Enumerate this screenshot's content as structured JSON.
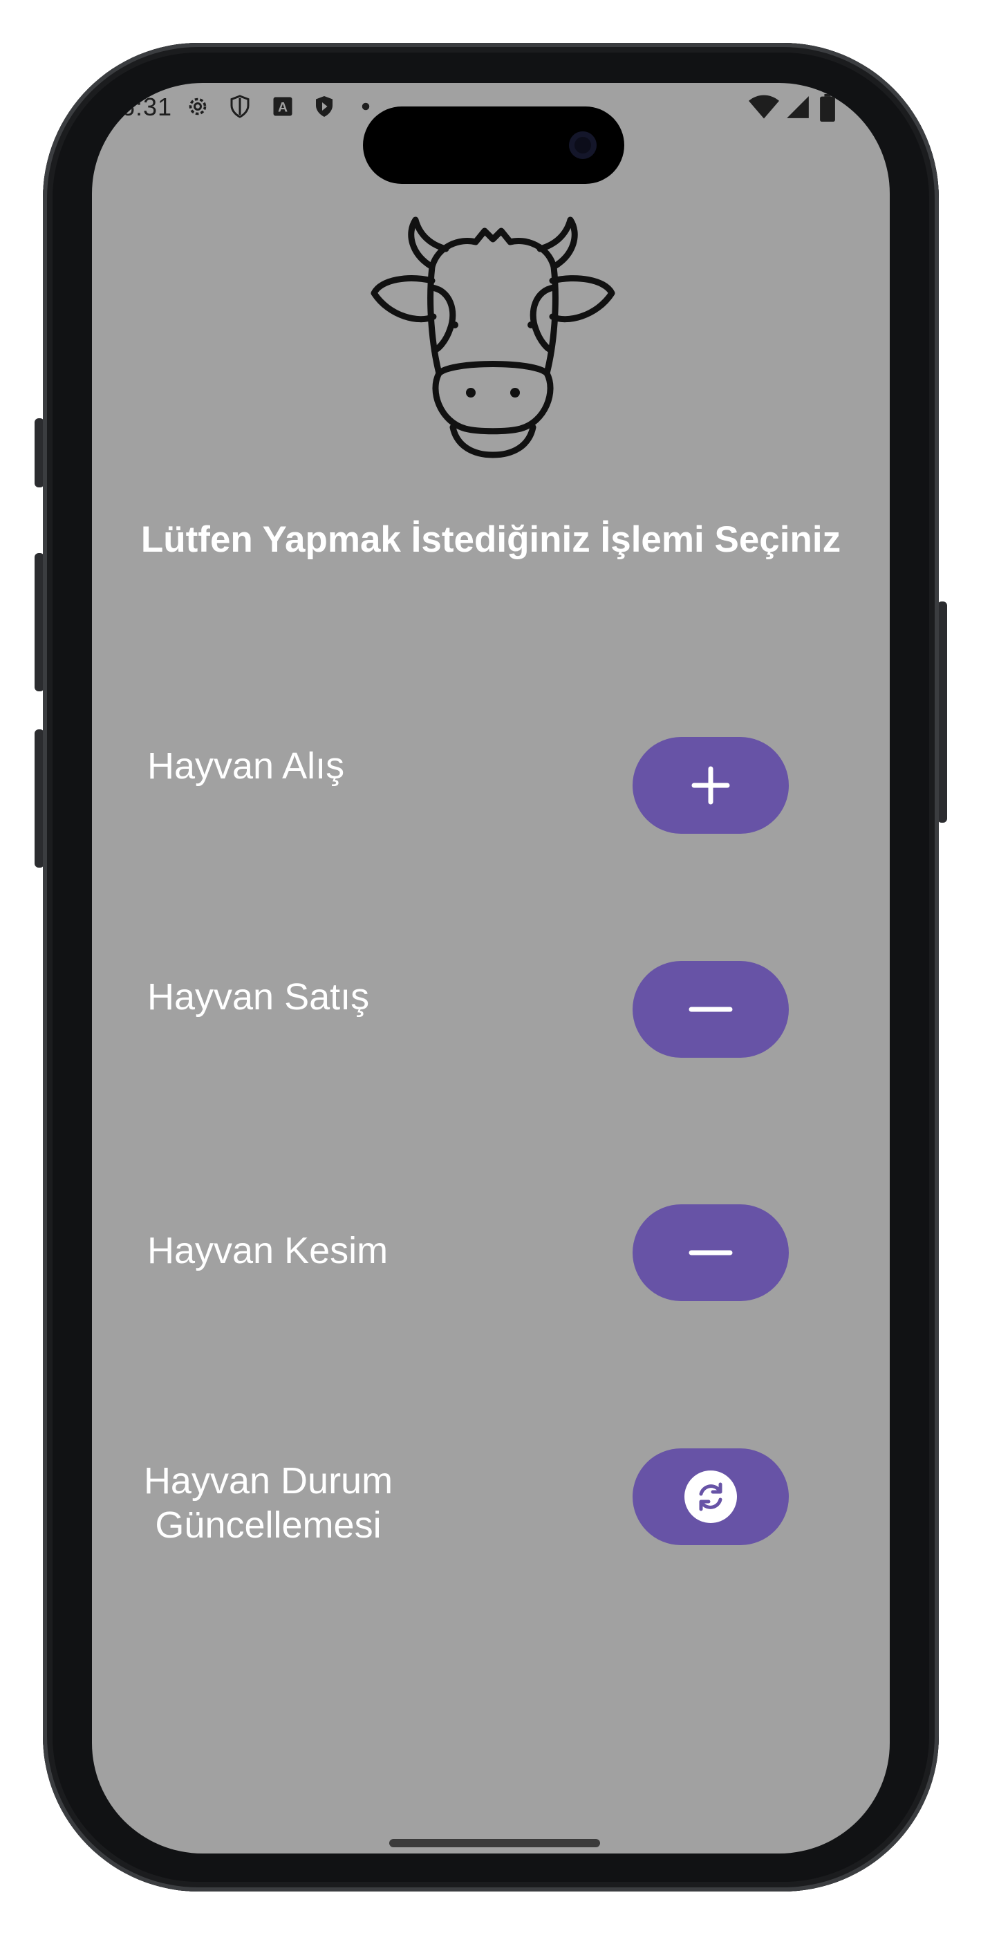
{
  "status_bar": {
    "time": "6:31",
    "left_icons": [
      "settings-icon",
      "shield-icon",
      "a-icon",
      "play-shield-icon",
      "dot-icon"
    ],
    "right_icons": [
      "wifi-icon",
      "signal-icon",
      "battery-icon"
    ]
  },
  "logo": {
    "icon": "cow-head-icon"
  },
  "title": "Lütfen Yapmak İstediğiniz İşlemi Seçiniz",
  "actions": [
    {
      "label": "Hayvan Alış",
      "icon": "plus-icon"
    },
    {
      "label": "Hayvan Satış",
      "icon": "minus-icon"
    },
    {
      "label": "Hayvan Kesim",
      "icon": "minus-icon"
    },
    {
      "label_line1": "Hayvan Durum",
      "label_line2": "Güncellemesi",
      "icon": "sync-icon"
    }
  ],
  "colors": {
    "background": "#a1a1a1",
    "button": "#6753a6",
    "text": "#ffffff"
  }
}
